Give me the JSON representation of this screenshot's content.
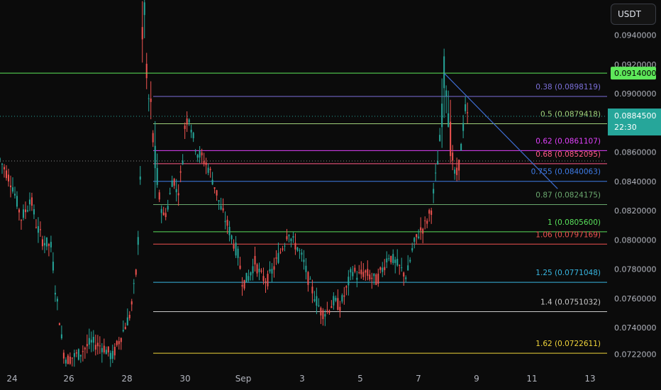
{
  "toolbar": {
    "currency_label": "USDT"
  },
  "chart_data": {
    "type": "candlestick",
    "price_axis": {
      "ticks": [
        "0.0940000",
        "0.0920000",
        "0.0900000",
        "0.0880000",
        "0.0860000",
        "0.0840000",
        "0.0820000",
        "0.0800000",
        "0.0780000",
        "0.0760000",
        "0.0740000",
        "0.0722000"
      ],
      "range": [
        0.0712,
        0.0964
      ]
    },
    "date_axis": {
      "ticks": [
        "24",
        "26",
        "28",
        "30",
        "Sep",
        "3",
        "5",
        "7",
        "9",
        "11",
        "13"
      ]
    },
    "fib_levels": [
      {
        "label": "0.38 (0.0898119)",
        "value": 0.0898119,
        "color": "#7b6fd8"
      },
      {
        "label": "0.5 (0.0879418)",
        "value": 0.0879418,
        "color": "#9fd07a"
      },
      {
        "label": "0.62 (0.0861107)",
        "value": 0.0861107,
        "color": "#e040fb"
      },
      {
        "label": "0.68 (0.0852095)",
        "value": 0.0852095,
        "color": "#ff5a85"
      },
      {
        "label": "0.755 (0.0840063)",
        "value": 0.0840063,
        "color": "#3e7ce8"
      },
      {
        "label": "0.87 (0.0824175)",
        "value": 0.0824175,
        "color": "#6aa86e"
      },
      {
        "label": "1 (0.0805600)",
        "value": 0.08056,
        "color": "#59e05b"
      },
      {
        "label": "1.06 (0.0797169)",
        "value": 0.0797169,
        "color": "#ef5350"
      },
      {
        "label": "1.25 (0.0771048)",
        "value": 0.0771048,
        "color": "#38b6e0"
      },
      {
        "label": "1.4 (0.0751032)",
        "value": 0.0751032,
        "color": "#c8c8c8"
      },
      {
        "label": "1.62 (0.0722611)",
        "value": 0.0722611,
        "color": "#f0d43a"
      }
    ],
    "horizontal_line": {
      "value": 0.0914,
      "label": "0.0914000",
      "color": "#5ee85a"
    },
    "current_price": {
      "value": 0.08845,
      "label": "0.0884500",
      "countdown": "22:30",
      "color": "#26a69a"
    },
    "dotted_line_value": 0.0854,
    "trendline": {
      "from": [
        0.7316,
        0.0914
      ],
      "to": [
        0.9185,
        0.0835
      ],
      "color": "#3e6cd0"
    },
    "candle_colors": {
      "up": "#26a69a",
      "down": "#ef5350"
    },
    "series": [
      {
        "x": 0.0,
        "y": 0.0855
      },
      {
        "x": 0.02,
        "y": 0.0838
      },
      {
        "x": 0.035,
        "y": 0.0815
      },
      {
        "x": 0.045,
        "y": 0.0822
      },
      {
        "x": 0.05,
        "y": 0.083
      },
      {
        "x": 0.06,
        "y": 0.081
      },
      {
        "x": 0.07,
        "y": 0.08
      },
      {
        "x": 0.085,
        "y": 0.0795
      },
      {
        "x": 0.09,
        "y": 0.077
      },
      {
        "x": 0.095,
        "y": 0.0755
      },
      {
        "x": 0.1,
        "y": 0.074
      },
      {
        "x": 0.103,
        "y": 0.0725
      },
      {
        "x": 0.11,
        "y": 0.0718
      },
      {
        "x": 0.13,
        "y": 0.0722
      },
      {
        "x": 0.15,
        "y": 0.073
      },
      {
        "x": 0.17,
        "y": 0.0727
      },
      {
        "x": 0.185,
        "y": 0.072
      },
      {
        "x": 0.2,
        "y": 0.0735
      },
      {
        "x": 0.215,
        "y": 0.075
      },
      {
        "x": 0.225,
        "y": 0.078
      },
      {
        "x": 0.23,
        "y": 0.082
      },
      {
        "x": 0.234,
        "y": 0.093
      },
      {
        "x": 0.238,
        "y": 0.096
      },
      {
        "x": 0.242,
        "y": 0.09
      },
      {
        "x": 0.248,
        "y": 0.089
      },
      {
        "x": 0.252,
        "y": 0.087
      },
      {
        "x": 0.257,
        "y": 0.0845
      },
      {
        "x": 0.262,
        "y": 0.083
      },
      {
        "x": 0.27,
        "y": 0.0815
      },
      {
        "x": 0.278,
        "y": 0.0825
      },
      {
        "x": 0.285,
        "y": 0.0845
      },
      {
        "x": 0.292,
        "y": 0.083
      },
      {
        "x": 0.3,
        "y": 0.085
      },
      {
        "x": 0.305,
        "y": 0.088
      },
      {
        "x": 0.312,
        "y": 0.0885
      },
      {
        "x": 0.318,
        "y": 0.087
      },
      {
        "x": 0.325,
        "y": 0.086
      },
      {
        "x": 0.335,
        "y": 0.0855
      },
      {
        "x": 0.345,
        "y": 0.0848
      },
      {
        "x": 0.355,
        "y": 0.0835
      },
      {
        "x": 0.365,
        "y": 0.082
      },
      {
        "x": 0.375,
        "y": 0.081
      },
      {
        "x": 0.383,
        "y": 0.08
      },
      {
        "x": 0.392,
        "y": 0.079
      },
      {
        "x": 0.4,
        "y": 0.077
      },
      {
        "x": 0.41,
        "y": 0.0775
      },
      {
        "x": 0.42,
        "y": 0.0785
      },
      {
        "x": 0.43,
        "y": 0.0775
      },
      {
        "x": 0.44,
        "y": 0.0772
      },
      {
        "x": 0.45,
        "y": 0.078
      },
      {
        "x": 0.46,
        "y": 0.079
      },
      {
        "x": 0.47,
        "y": 0.08
      },
      {
        "x": 0.475,
        "y": 0.0808
      },
      {
        "x": 0.48,
        "y": 0.08
      },
      {
        "x": 0.49,
        "y": 0.0795
      },
      {
        "x": 0.5,
        "y": 0.0785
      },
      {
        "x": 0.51,
        "y": 0.077
      },
      {
        "x": 0.52,
        "y": 0.076
      },
      {
        "x": 0.53,
        "y": 0.075
      },
      {
        "x": 0.54,
        "y": 0.0752
      },
      {
        "x": 0.55,
        "y": 0.0758
      },
      {
        "x": 0.56,
        "y": 0.0755
      },
      {
        "x": 0.57,
        "y": 0.0765
      },
      {
        "x": 0.58,
        "y": 0.078
      },
      {
        "x": 0.59,
        "y": 0.0775
      },
      {
        "x": 0.6,
        "y": 0.0778
      },
      {
        "x": 0.61,
        "y": 0.0775
      },
      {
        "x": 0.62,
        "y": 0.0772
      },
      {
        "x": 0.63,
        "y": 0.078
      },
      {
        "x": 0.64,
        "y": 0.079
      },
      {
        "x": 0.65,
        "y": 0.0785
      },
      {
        "x": 0.66,
        "y": 0.078
      },
      {
        "x": 0.67,
        "y": 0.0775
      },
      {
        "x": 0.68,
        "y": 0.0795
      },
      {
        "x": 0.69,
        "y": 0.0805
      },
      {
        "x": 0.7,
        "y": 0.081
      },
      {
        "x": 0.71,
        "y": 0.082
      },
      {
        "x": 0.715,
        "y": 0.0835
      },
      {
        "x": 0.72,
        "y": 0.085
      },
      {
        "x": 0.725,
        "y": 0.087
      },
      {
        "x": 0.73,
        "y": 0.0905
      },
      {
        "x": 0.733,
        "y": 0.092
      },
      {
        "x": 0.737,
        "y": 0.09
      },
      {
        "x": 0.742,
        "y": 0.087
      },
      {
        "x": 0.748,
        "y": 0.0845
      },
      {
        "x": 0.754,
        "y": 0.0845
      },
      {
        "x": 0.76,
        "y": 0.0865
      },
      {
        "x": 0.766,
        "y": 0.089
      },
      {
        "x": 0.77,
        "y": 0.08845
      }
    ]
  }
}
